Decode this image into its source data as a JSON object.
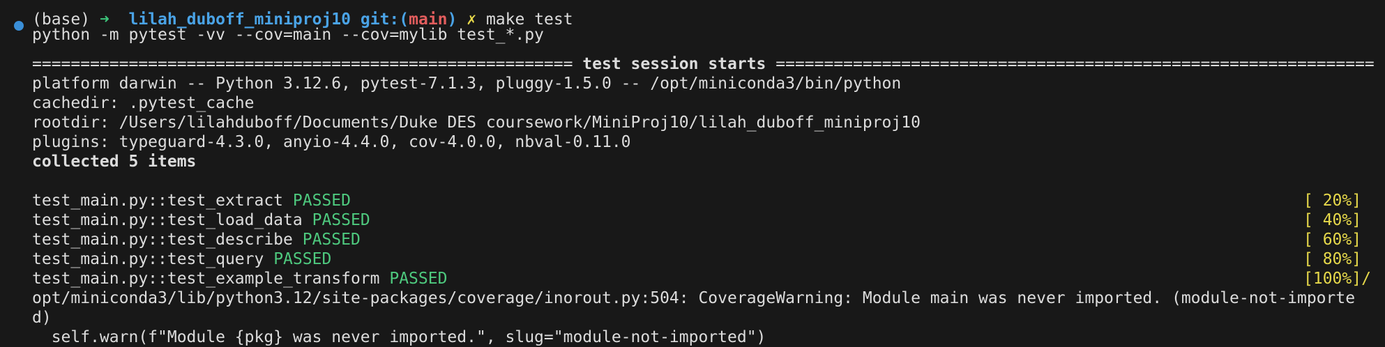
{
  "prompt": {
    "env": "(base)",
    "arrow": "➜",
    "dir": "lilah_duboff_miniproj10",
    "git_label": "git:(",
    "branch": "main",
    "git_close": ")",
    "dirty_mark": "✗",
    "command": "make test"
  },
  "lines": {
    "cmd": "python -m pytest -vv --cov=main --cov=mylib test_*.py",
    "session_left": "========================================================",
    "session_title": " test session starts ",
    "session_right": "==============================================================",
    "platform": "platform darwin -- Python 3.12.6, pytest-7.1.3, pluggy-1.5.0 -- /opt/miniconda3/bin/python",
    "cachedir": "cachedir: .pytest_cache",
    "rootdir": "rootdir: /Users/lilahduboff/Documents/Duke DES coursework/MiniProj10/lilah_duboff_miniproj10",
    "plugins": "plugins: typeguard-4.3.0, anyio-4.4.0, cov-4.0.0, nbval-0.11.0",
    "collected": "collected 5 items"
  },
  "tests": [
    {
      "name": "test_main.py::test_extract",
      "status": "PASSED",
      "pct": "[ 20%]"
    },
    {
      "name": "test_main.py::test_load_data",
      "status": "PASSED",
      "pct": "[ 40%]"
    },
    {
      "name": "test_main.py::test_describe",
      "status": "PASSED",
      "pct": "[ 60%]"
    },
    {
      "name": "test_main.py::test_query",
      "status": "PASSED",
      "pct": "[ 80%]"
    },
    {
      "name": "test_main.py::test_example_transform",
      "status": "PASSED",
      "pct": "[100%]"
    }
  ],
  "trailing_slash": "/",
  "warning": {
    "line1": "opt/miniconda3/lib/python3.12/site-packages/coverage/inorout.py:504: CoverageWarning: Module main was never imported. (module-not-importe",
    "line2": "d)",
    "line3": "  self.warn(f\"Module {pkg} was never imported.\", slug=\"module-not-imported\")"
  },
  "colors": {
    "background": "#181818",
    "text": "#dcdcdc",
    "passed": "#4ec97e",
    "percent": "#e6d84a",
    "dir": "#4aa3e6",
    "branch": "#e25d5d"
  }
}
